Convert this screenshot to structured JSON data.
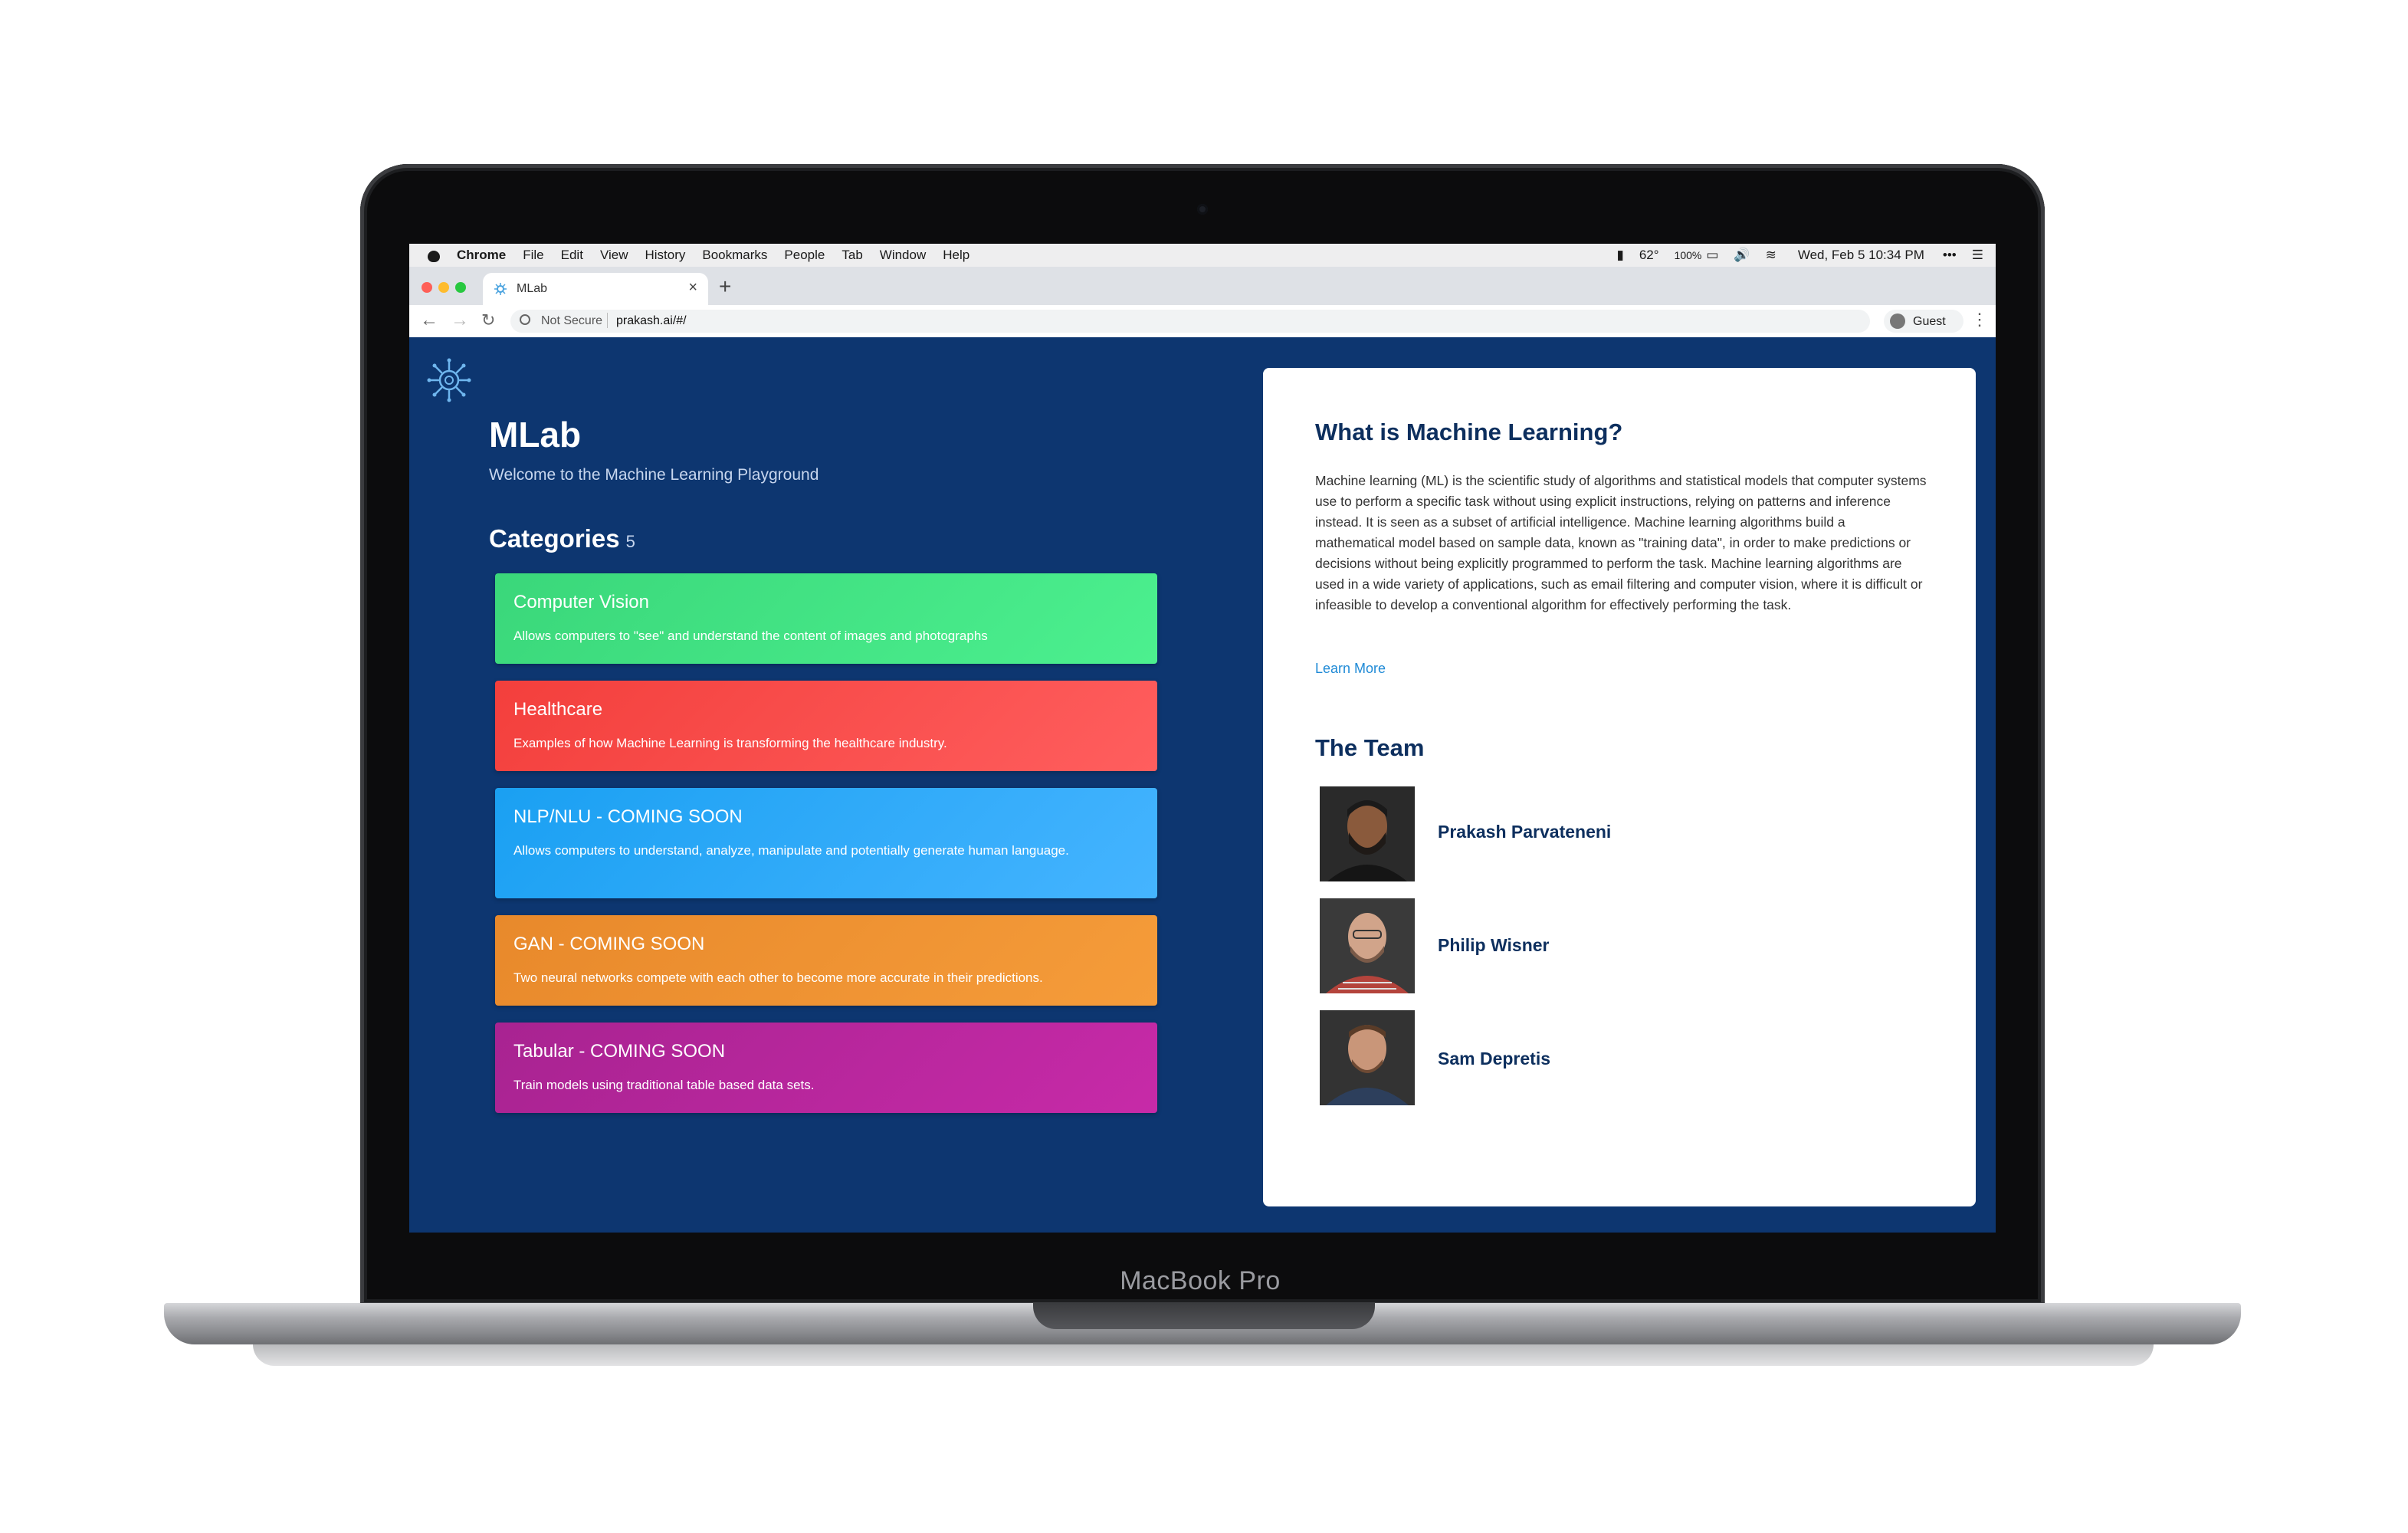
{
  "laptop": {
    "label": "MacBook Pro"
  },
  "menubar": {
    "app": "Chrome",
    "items": [
      "File",
      "Edit",
      "View",
      "History",
      "Bookmarks",
      "People",
      "Tab",
      "Window",
      "Help"
    ],
    "status": {
      "temperature": "62°",
      "battery": "100%",
      "datetime": "Wed, Feb 5  10:34 PM"
    }
  },
  "browser": {
    "tab_title": "MLab",
    "security": "Not Secure",
    "url": "prakash.ai/#/",
    "profile": "Guest"
  },
  "page": {
    "title": "MLab",
    "subtitle": "Welcome to the Machine Learning Playground",
    "categories_heading": "Categories",
    "categories_count": "5",
    "categories": [
      {
        "title": "Computer Vision",
        "description": "Allows computers to \"see\" and understand the content of images and photographs",
        "color_start": "#3ad77a",
        "color_end": "#4cf08f"
      },
      {
        "title": "Healthcare",
        "description": "Examples of how Machine Learning is transforming the healthcare industry.",
        "color_start": "#f33f3c",
        "color_end": "#ff5e5e"
      },
      {
        "title": "NLP/NLU - COMING SOON",
        "description": "Allows computers to understand, analyze, manipulate and potentially generate human language.",
        "color_start": "#1aa0f2",
        "color_end": "#45b4ff"
      },
      {
        "title": "GAN - COMING SOON",
        "description": "Two neural networks compete with each other to become more accurate in their predictions.",
        "color_start": "#e8892b",
        "color_end": "#f59c3a"
      },
      {
        "title": "Tabular - COMING SOON",
        "description": "Train models using traditional table based data sets.",
        "color_start": "#a82391",
        "color_end": "#c72aa8"
      }
    ]
  },
  "info": {
    "ml_heading": "What is Machine Learning?",
    "ml_text": "Machine learning (ML) is the scientific study of algorithms and statistical models that computer systems use to perform a specific task without using explicit instructions, relying on patterns and inference instead. It is seen as a subset of artificial intelligence. Machine learning algorithms build a mathematical model based on sample data, known as \"training data\", in order to make predictions or decisions without being explicitly programmed to perform the task. Machine learning algorithms are used in a wide variety of applications, such as email filtering and computer vision, where it is difficult or infeasible to develop a conventional algorithm for effectively performing the task.",
    "learn_more": "Learn More",
    "team_heading": "The Team",
    "team": [
      {
        "name": "Prakash Parvateneni"
      },
      {
        "name": "Philip Wisner"
      },
      {
        "name": "Sam Depretis"
      }
    ]
  },
  "colors": {
    "page_bg": "#0d3670",
    "heading": "#0d2f5e",
    "link": "#1f8ad6"
  }
}
